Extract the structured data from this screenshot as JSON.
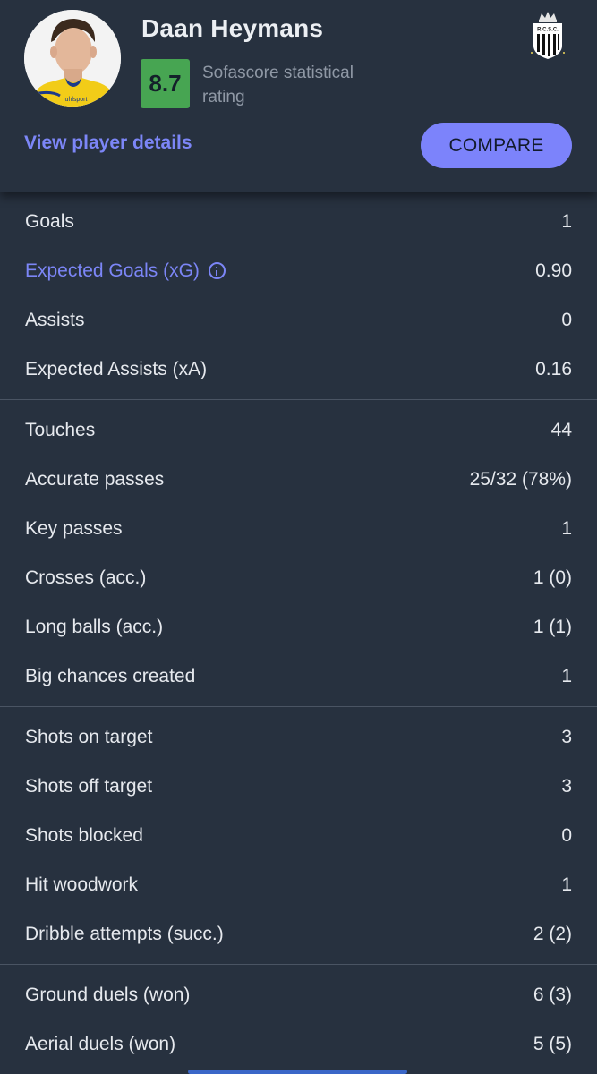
{
  "player": {
    "name": "Daan Heymans",
    "rating": "8.7",
    "rating_label": "Sofascore statistical rating",
    "view_details": "View player details",
    "compare": "COMPARE",
    "avatar_shirt_text": "uhlsport",
    "crest_text": "R.C.S.C."
  },
  "colors": {
    "background": "#27313f",
    "accent": "#7c83fb",
    "rating_green": "#47a552"
  },
  "groups": [
    [
      {
        "label": "Goals",
        "value": "1"
      },
      {
        "label": "Expected Goals (xG)",
        "value": "0.90",
        "link": true
      },
      {
        "label": "Assists",
        "value": "0"
      },
      {
        "label": "Expected Assists (xA)",
        "value": "0.16"
      }
    ],
    [
      {
        "label": "Touches",
        "value": "44"
      },
      {
        "label": "Accurate passes",
        "value": "25/32 (78%)"
      },
      {
        "label": "Key passes",
        "value": "1"
      },
      {
        "label": "Crosses (acc.)",
        "value": "1 (0)"
      },
      {
        "label": "Long balls (acc.)",
        "value": "1 (1)"
      },
      {
        "label": "Big chances created",
        "value": "1"
      }
    ],
    [
      {
        "label": "Shots on target",
        "value": "3"
      },
      {
        "label": "Shots off target",
        "value": "3"
      },
      {
        "label": "Shots blocked",
        "value": "0"
      },
      {
        "label": "Hit woodwork",
        "value": "1"
      },
      {
        "label": "Dribble attempts (succ.)",
        "value": "2 (2)"
      }
    ],
    [
      {
        "label": "Ground duels (won)",
        "value": "6 (3)"
      },
      {
        "label": "Aerial duels (won)",
        "value": "5 (5)"
      }
    ]
  ]
}
